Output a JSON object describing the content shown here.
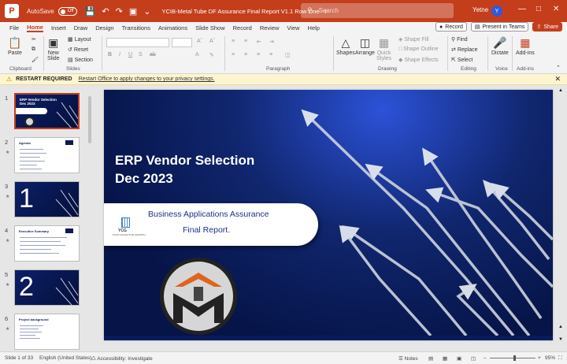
{
  "titlebar": {
    "autosave_label": "AutoSave",
    "autosave_state": "Off",
    "document_title": "YCIB-Metal Tube DF Assurance Final Report V1.1 Row One · Power...",
    "search_placeholder": "Search",
    "user_name": "Yetne",
    "user_initial": "Y",
    "brand_color": "#c43e1c"
  },
  "menu": {
    "tabs": [
      "File",
      "Home",
      "Insert",
      "Draw",
      "Design",
      "Transitions",
      "Animations",
      "Slide Show",
      "Record",
      "Review",
      "View",
      "Help"
    ],
    "active": "Home",
    "record_label": "Record",
    "present_label": "Present in Teams",
    "share_label": "Share"
  },
  "ribbon": {
    "paste": "Paste",
    "new_slide_1": "New",
    "new_slide_2": "Slide",
    "layout": "Layout",
    "reset": "Reset",
    "section": "Section",
    "shapes": "Shapes",
    "arrange": "Arrange",
    "quick_styles_1": "Quick",
    "quick_styles_2": "Styles",
    "shape_fill": "Shape Fill",
    "shape_outline": "Shape Outline",
    "shape_effects": "Shape Effects",
    "find": "Find",
    "replace": "Replace",
    "select": "Select",
    "dictate": "Dictate",
    "addins_1": "Add-ins",
    "groups": {
      "clipboard": "Clipboard",
      "slides": "Slides",
      "paragraph": "Paragraph",
      "drawing": "Drawing",
      "editing": "Editing",
      "voice": "Voice",
      "addins": "Add-ins"
    }
  },
  "notification": {
    "label": "RESTART REQUIRED",
    "message": "Restart Office to apply changes to your privacy settings."
  },
  "thumbnails": [
    {
      "num": "1",
      "title": "ERP Vendor Selection\nDec 2023",
      "kind": "title",
      "selected": true
    },
    {
      "num": "2",
      "title": "Agenda",
      "kind": "list",
      "selected": false
    },
    {
      "num": "3",
      "title": "1",
      "kind": "section",
      "selected": false
    },
    {
      "num": "4",
      "title": "Executive Summary",
      "kind": "list",
      "selected": false
    },
    {
      "num": "5",
      "title": "2",
      "kind": "section",
      "selected": false
    },
    {
      "num": "6",
      "title": "Project background",
      "kind": "list",
      "selected": false
    }
  ],
  "slide": {
    "title_line1": "ERP Vendor Selection",
    "title_line2": "Dec 2023",
    "callout_line1": "Business Applications Assurance",
    "callout_line2": "Final Report.",
    "logo_text": "YCG",
    "logo_sub": "YOUR COLLECTIVE GROWTH"
  },
  "status": {
    "slide_counter": "Slide 1 of 33",
    "language": "English (United States)",
    "accessibility": "Accessibility: Investigate",
    "notes": "Notes",
    "zoom": "95%"
  }
}
